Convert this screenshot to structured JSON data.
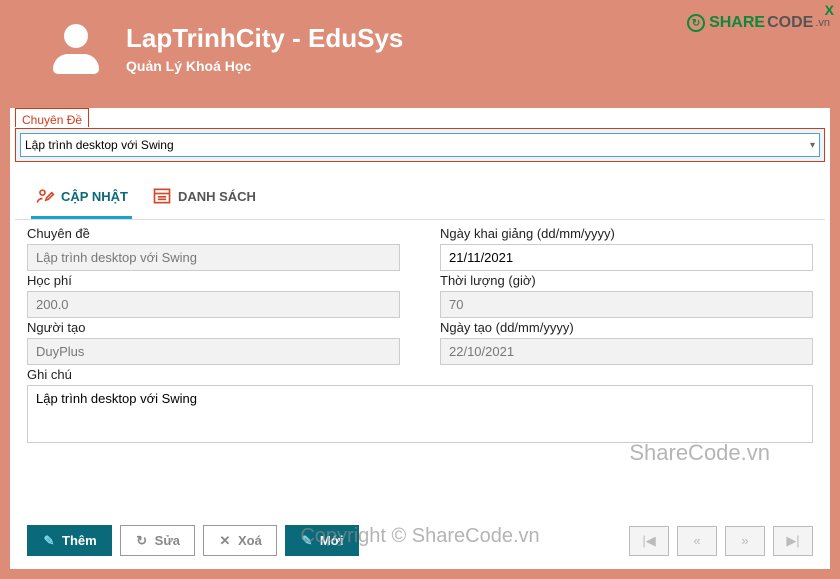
{
  "brand": {
    "part1": "SHARE",
    "part2": "CODE",
    "suffix": ".vn"
  },
  "header": {
    "title": "LapTrinhCity - EduSys",
    "subtitle": "Quản Lý Khoá Học"
  },
  "close_label": "X",
  "group_label": "Chuyên Đề",
  "combo_value": "Lập trình desktop với Swing",
  "tabs": {
    "update": "CẬP NHẬT",
    "list": "DANH SÁCH"
  },
  "fields": {
    "chuyen_de": {
      "label": "Chuyên đề",
      "value": "Lập trình desktop với Swing"
    },
    "ngay_kg": {
      "label": "Ngày khai giảng (dd/mm/yyyy)",
      "value": "21/11/2021"
    },
    "hoc_phi": {
      "label": "Học phí",
      "value": "200.0"
    },
    "thoi_luong": {
      "label": "Thời lượng (giờ)",
      "value": "70"
    },
    "nguoi_tao": {
      "label": "Người tạo",
      "value": "DuyPlus"
    },
    "ngay_tao": {
      "label": "Ngày tạo (dd/mm/yyyy)",
      "value": "22/10/2021"
    },
    "ghi_chu": {
      "label": "Ghi chú",
      "value": "Lập trình desktop với Swing"
    }
  },
  "buttons": {
    "them": "Thêm",
    "sua": "Sửa",
    "xoa": "Xoá",
    "moi": "Mới"
  },
  "nav_glyphs": {
    "first": "⏮",
    "prev": "«",
    "next": "»",
    "last": "⏭"
  },
  "watermark1": "ShareCode.vn",
  "watermark2": "Copyright © ShareCode.vn"
}
